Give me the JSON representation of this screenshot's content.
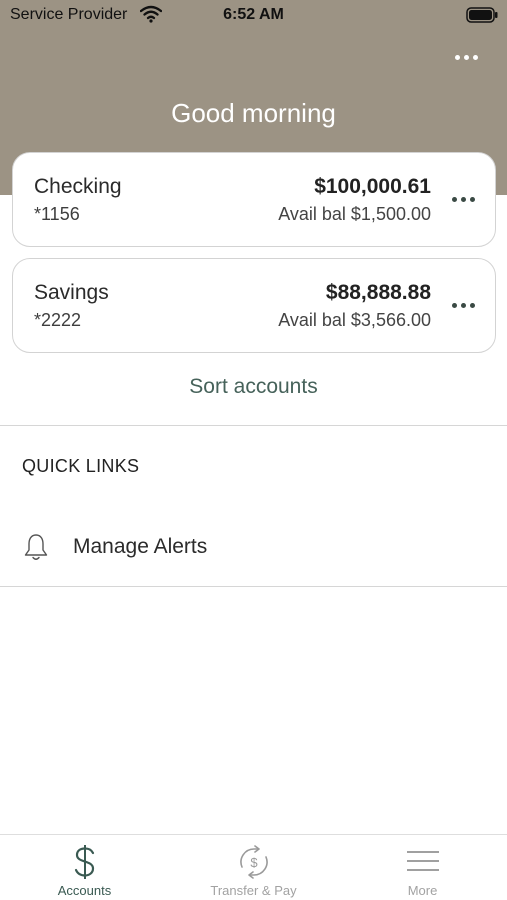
{
  "status_bar": {
    "carrier": "Service Provider",
    "time": "6:52 AM"
  },
  "header": {
    "greeting": "Good morning",
    "background_color": "#9c9384"
  },
  "accounts": [
    {
      "name": "Checking",
      "number": "*1156",
      "balance": "$100,000.61",
      "available": "Avail bal $1,500.00"
    },
    {
      "name": "Savings",
      "number": "*2222",
      "balance": "$88,888.88",
      "available": "Avail bal $3,566.00"
    }
  ],
  "sort_accounts_label": "Sort accounts",
  "quick_links": {
    "title": "QUICK LINKS",
    "items": [
      {
        "label": "Manage Alerts",
        "icon": "bell-icon"
      }
    ]
  },
  "tab_bar": {
    "active": "Accounts",
    "accent_color": "#3a5a52",
    "tabs": [
      {
        "label": "Accounts",
        "icon": "dollar-icon"
      },
      {
        "label": "Transfer & Pay",
        "icon": "transfer-pay-icon"
      },
      {
        "label": "More",
        "icon": "menu-icon"
      }
    ]
  }
}
